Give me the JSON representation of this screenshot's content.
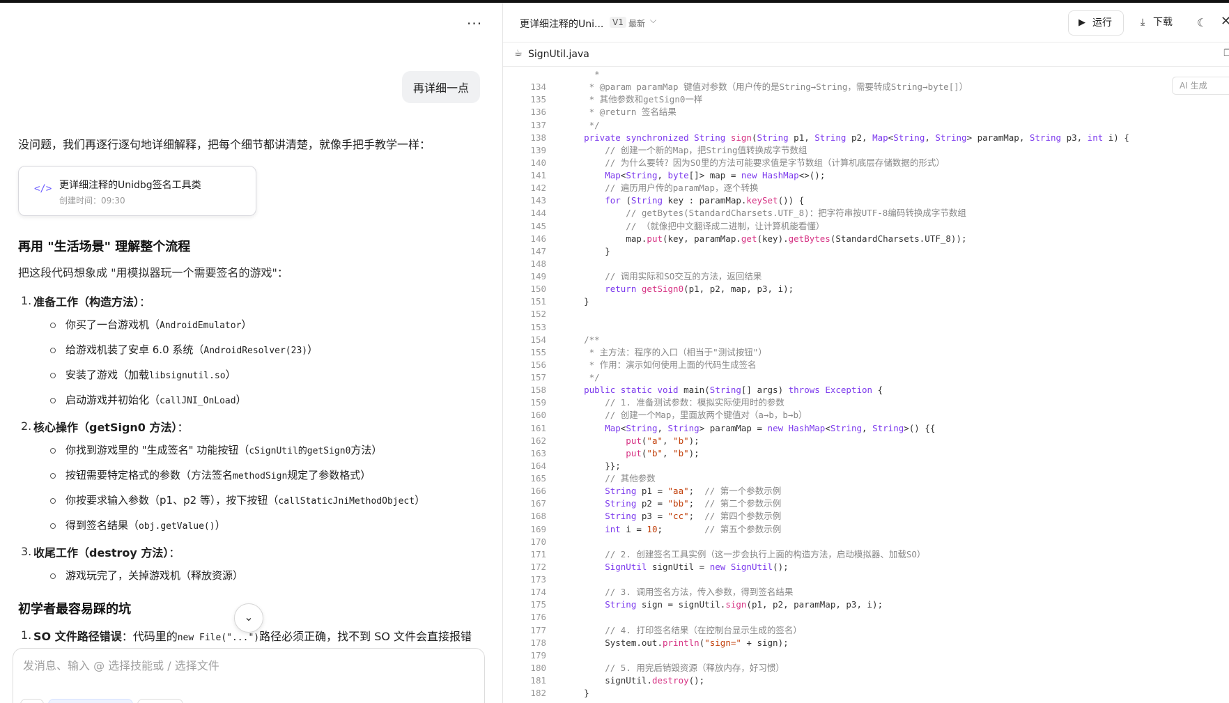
{
  "chat": {
    "more_label": "···",
    "user_message": "再详细一点",
    "intro": "没问题，我们再逐行逐句地详细解释，把每个细节都讲清楚，就像手把手教学一样：",
    "artifact": {
      "icon": "</>",
      "title": "更详细注释的Unidbg签名工具类",
      "time": "创建时间：09:30"
    },
    "section1_title": "再用 \"生活场景\" 理解整个流程",
    "section1_para": "把这段代码想象成 \"用模拟器玩一个需要签名的游戏\"：",
    "steps": [
      {
        "num": "1.",
        "title": "准备工作（构造方法）",
        "suffix": "：",
        "items": [
          {
            "text": "你买了一台游戏机（",
            "code": "AndroidEmulator",
            "tail": "）"
          },
          {
            "text": "给游戏机装了安卓 6.0 系统（",
            "code": "AndroidResolver(23)",
            "tail": "）"
          },
          {
            "text": "安装了游戏（加载",
            "code": "libsignutil.so",
            "tail": "）"
          },
          {
            "text": "启动游戏并初始化（",
            "code": "callJNI_OnLoad",
            "tail": "）"
          }
        ]
      },
      {
        "num": "2.",
        "title": "核心操作（getSign0 方法）",
        "suffix": "：",
        "items": [
          {
            "text": "你找到游戏里的 \"生成签名\" 功能按钮（",
            "code": "cSignUtil的getSign0",
            "tail": "方法）"
          },
          {
            "text": "按钮需要特定格式的参数（方法签名",
            "code": "methodSign",
            "tail": "规定了参数格式）"
          },
          {
            "text": "你按要求输入参数（p1、p2 等），按下按钮（",
            "code": "callStaticJniMethodObject",
            "tail": "）"
          },
          {
            "text": "得到签名结果（",
            "code": "obj.getValue()",
            "tail": "）"
          }
        ]
      },
      {
        "num": "3.",
        "title": "收尾工作（destroy 方法）",
        "suffix": "：",
        "items": [
          {
            "text": "游戏玩完了，关掉游戏机（释放资源）",
            "code": "",
            "tail": ""
          }
        ]
      }
    ],
    "section2_title": "初学者最容易踩的坑",
    "pitfall": {
      "num": "1.",
      "title": "SO 文件路径错误",
      "text": "：代码里的",
      "code": "new File(\"...\")",
      "tail": "路径必须正确，找不到 SO 文件会直接报错"
    },
    "scroll_down_icon": "⌄",
    "input_placeholder": "发消息、输入 @ 选择技能或 / 选择文件"
  },
  "code_pane": {
    "title": "更详细注释的Uni...",
    "version": "V1",
    "latest": "最新",
    "chevron": "⌵",
    "run_label": "运行",
    "run_icon": "▶",
    "download_label": "下载",
    "download_icon": "⤓",
    "theme_icon": "☾",
    "close_icon": "✕",
    "file_icon": "☕",
    "file_name": "SignUtil.java",
    "copy_icon": "❐",
    "ai_badge": "AI 生成",
    "lines": [
      {
        "n": "",
        "t": [
          [
            "cm",
            "      *"
          ]
        ]
      },
      {
        "n": "134",
        "t": [
          [
            "cm",
            "     * @param paramMap 键值对参数（用户传的是String→String，需要转成String→byte[]）"
          ]
        ]
      },
      {
        "n": "135",
        "t": [
          [
            "cm",
            "     * 其他参数和getSign0一样"
          ]
        ]
      },
      {
        "n": "136",
        "t": [
          [
            "cm",
            "     * @return 签名结果"
          ]
        ]
      },
      {
        "n": "137",
        "t": [
          [
            "cm",
            "     */"
          ]
        ]
      },
      {
        "n": "138",
        "t": [
          [
            "kw",
            "    private synchronized "
          ],
          [
            "ty",
            "String "
          ],
          [
            "fn",
            "sign"
          ],
          [
            "id",
            "("
          ],
          [
            "ty",
            "String "
          ],
          [
            "id",
            "p1, "
          ],
          [
            "ty",
            "String "
          ],
          [
            "id",
            "p2, "
          ],
          [
            "ty",
            "Map"
          ],
          [
            "id",
            "<"
          ],
          [
            "ty",
            "String"
          ],
          [
            "id",
            ", "
          ],
          [
            "ty",
            "String"
          ],
          [
            "id",
            "> paramMap, "
          ],
          [
            "ty",
            "String "
          ],
          [
            "id",
            "p3, "
          ],
          [
            "kw",
            "int "
          ],
          [
            "id",
            "i) {"
          ]
        ]
      },
      {
        "n": "139",
        "t": [
          [
            "cm",
            "        // 创建一个新的Map，把String值转换成字节数组"
          ]
        ]
      },
      {
        "n": "140",
        "t": [
          [
            "cm",
            "        // 为什么要转？因为SO里的方法可能要求值是字节数组（计算机底层存储数据的形式）"
          ]
        ]
      },
      {
        "n": "141",
        "t": [
          [
            "ty",
            "        Map"
          ],
          [
            "id",
            "<"
          ],
          [
            "ty",
            "String"
          ],
          [
            "id",
            ", "
          ],
          [
            "kw",
            "byte"
          ],
          [
            "id",
            "[]> map = "
          ],
          [
            "kw",
            "new "
          ],
          [
            "ty",
            "HashMap"
          ],
          [
            "id",
            "<>();"
          ]
        ]
      },
      {
        "n": "142",
        "t": [
          [
            "cm",
            "        // 遍历用户传的paramMap，逐个转换"
          ]
        ]
      },
      {
        "n": "143",
        "t": [
          [
            "kw",
            "        for "
          ],
          [
            "id",
            "("
          ],
          [
            "ty",
            "String "
          ],
          [
            "id",
            "key : paramMap."
          ],
          [
            "fn",
            "keySet"
          ],
          [
            "id",
            "()) {"
          ]
        ]
      },
      {
        "n": "144",
        "t": [
          [
            "cm",
            "            // getBytes(StandardCharsets.UTF_8)：把字符串按UTF-8编码转换成字节数组"
          ]
        ]
      },
      {
        "n": "145",
        "t": [
          [
            "cm",
            "            // （就像把中文翻译成二进制，让计算机能看懂）"
          ]
        ]
      },
      {
        "n": "146",
        "t": [
          [
            "id",
            "            map."
          ],
          [
            "fn",
            "put"
          ],
          [
            "id",
            "(key, paramMap."
          ],
          [
            "fn",
            "get"
          ],
          [
            "id",
            "(key)."
          ],
          [
            "fn",
            "getBytes"
          ],
          [
            "id",
            "(StandardCharsets.UTF_8));"
          ]
        ]
      },
      {
        "n": "147",
        "t": [
          [
            "id",
            "        }"
          ]
        ]
      },
      {
        "n": "148",
        "t": [
          [
            "id",
            ""
          ]
        ]
      },
      {
        "n": "149",
        "t": [
          [
            "cm",
            "        // 调用实际和SO交互的方法，返回结果"
          ]
        ]
      },
      {
        "n": "150",
        "t": [
          [
            "kw",
            "        return "
          ],
          [
            "fn",
            "getSign0"
          ],
          [
            "id",
            "(p1, p2, map, p3, i);"
          ]
        ]
      },
      {
        "n": "151",
        "t": [
          [
            "id",
            "    }"
          ]
        ]
      },
      {
        "n": "152",
        "t": [
          [
            "id",
            ""
          ]
        ]
      },
      {
        "n": "153",
        "t": [
          [
            "id",
            ""
          ]
        ]
      },
      {
        "n": "154",
        "t": [
          [
            "cm",
            "    /**"
          ]
        ]
      },
      {
        "n": "155",
        "t": [
          [
            "cm",
            "     * 主方法：程序的入口（相当于\"测试按钮\"）"
          ]
        ]
      },
      {
        "n": "156",
        "t": [
          [
            "cm",
            "     * 作用：演示如何使用上面的代码生成签名"
          ]
        ]
      },
      {
        "n": "157",
        "t": [
          [
            "cm",
            "     */"
          ]
        ]
      },
      {
        "n": "158",
        "t": [
          [
            "kw",
            "    public static void "
          ],
          [
            "id",
            "main("
          ],
          [
            "ty",
            "String"
          ],
          [
            "id",
            "[] args) "
          ],
          [
            "kw",
            "throws "
          ],
          [
            "ty",
            "Exception "
          ],
          [
            "id",
            "{"
          ]
        ]
      },
      {
        "n": "159",
        "t": [
          [
            "cm",
            "        // 1. 准备测试参数：模拟实际使用时的参数"
          ]
        ]
      },
      {
        "n": "160",
        "t": [
          [
            "cm",
            "        // 创建一个Map，里面放两个键值对（a→b，b→b）"
          ]
        ]
      },
      {
        "n": "161",
        "t": [
          [
            "ty",
            "        Map"
          ],
          [
            "id",
            "<"
          ],
          [
            "ty",
            "String"
          ],
          [
            "id",
            ", "
          ],
          [
            "ty",
            "String"
          ],
          [
            "id",
            "> paramMap = "
          ],
          [
            "kw",
            "new "
          ],
          [
            "ty",
            "HashMap"
          ],
          [
            "id",
            "<"
          ],
          [
            "ty",
            "String"
          ],
          [
            "id",
            ", "
          ],
          [
            "ty",
            "String"
          ],
          [
            "id",
            ">() {{"
          ]
        ]
      },
      {
        "n": "162",
        "t": [
          [
            "fn",
            "            put"
          ],
          [
            "id",
            "("
          ],
          [
            "str",
            "\"a\""
          ],
          [
            "id",
            ", "
          ],
          [
            "str",
            "\"b\""
          ],
          [
            "id",
            ");"
          ]
        ]
      },
      {
        "n": "163",
        "t": [
          [
            "fn",
            "            put"
          ],
          [
            "id",
            "("
          ],
          [
            "str",
            "\"b\""
          ],
          [
            "id",
            ", "
          ],
          [
            "str",
            "\"b\""
          ],
          [
            "id",
            ");"
          ]
        ]
      },
      {
        "n": "164",
        "t": [
          [
            "id",
            "        }};"
          ]
        ]
      },
      {
        "n": "165",
        "t": [
          [
            "cm",
            "        // 其他参数"
          ]
        ]
      },
      {
        "n": "166",
        "t": [
          [
            "ty",
            "        String "
          ],
          [
            "id",
            "p1 = "
          ],
          [
            "str",
            "\"aa\""
          ],
          [
            "id",
            ";  "
          ],
          [
            "cm",
            "// 第一个参数示例"
          ]
        ]
      },
      {
        "n": "167",
        "t": [
          [
            "ty",
            "        String "
          ],
          [
            "id",
            "p2 = "
          ],
          [
            "str",
            "\"bb\""
          ],
          [
            "id",
            ";  "
          ],
          [
            "cm",
            "// 第二个参数示例"
          ]
        ]
      },
      {
        "n": "168",
        "t": [
          [
            "ty",
            "        String "
          ],
          [
            "id",
            "p3 = "
          ],
          [
            "str",
            "\"cc\""
          ],
          [
            "id",
            ";  "
          ],
          [
            "cm",
            "// 第四个参数示例"
          ]
        ]
      },
      {
        "n": "169",
        "t": [
          [
            "kw",
            "        int "
          ],
          [
            "id",
            "i = "
          ],
          [
            "num",
            "10"
          ],
          [
            "id",
            ";        "
          ],
          [
            "cm",
            "// 第五个参数示例"
          ]
        ]
      },
      {
        "n": "170",
        "t": [
          [
            "id",
            ""
          ]
        ]
      },
      {
        "n": "171",
        "t": [
          [
            "cm",
            "        // 2. 创建签名工具实例（这一步会执行上面的构造方法，启动模拟器、加载SO）"
          ]
        ]
      },
      {
        "n": "172",
        "t": [
          [
            "ty",
            "        SignUtil "
          ],
          [
            "id",
            "signUtil = "
          ],
          [
            "kw",
            "new "
          ],
          [
            "ty",
            "SignUtil"
          ],
          [
            "id",
            "();"
          ]
        ]
      },
      {
        "n": "173",
        "t": [
          [
            "id",
            ""
          ]
        ]
      },
      {
        "n": "174",
        "t": [
          [
            "cm",
            "        // 3. 调用签名方法，传入参数，得到签名结果"
          ]
        ]
      },
      {
        "n": "175",
        "t": [
          [
            "ty",
            "        String "
          ],
          [
            "id",
            "sign = signUtil."
          ],
          [
            "fn",
            "sign"
          ],
          [
            "id",
            "(p1, p2, paramMap, p3, i);"
          ]
        ]
      },
      {
        "n": "176",
        "t": [
          [
            "id",
            ""
          ]
        ]
      },
      {
        "n": "177",
        "t": [
          [
            "cm",
            "        // 4. 打印签名结果（在控制台显示生成的签名）"
          ]
        ]
      },
      {
        "n": "178",
        "t": [
          [
            "id",
            "        System.out."
          ],
          [
            "fn",
            "println"
          ],
          [
            "id",
            "("
          ],
          [
            "str",
            "\"sign=\""
          ],
          [
            "id",
            " + sign);"
          ]
        ]
      },
      {
        "n": "179",
        "t": [
          [
            "id",
            ""
          ]
        ]
      },
      {
        "n": "180",
        "t": [
          [
            "cm",
            "        // 5. 用完后销毁资源（释放内存，好习惯）"
          ]
        ]
      },
      {
        "n": "181",
        "t": [
          [
            "id",
            "        signUtil."
          ],
          [
            "fn",
            "destroy"
          ],
          [
            "id",
            "();"
          ]
        ]
      },
      {
        "n": "182",
        "t": [
          [
            "id",
            "    }"
          ]
        ]
      }
    ]
  }
}
